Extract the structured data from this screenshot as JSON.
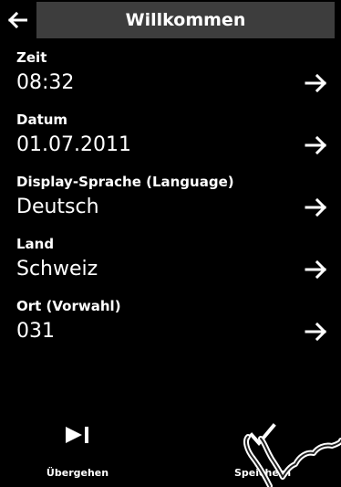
{
  "header": {
    "title": "Willkommen",
    "back_icon": "arrow-left-icon"
  },
  "settings": [
    {
      "label": "Zeit",
      "value": "08:32"
    },
    {
      "label": "Datum",
      "value": "01.07.2011"
    },
    {
      "label": "Display-Sprache (Language)",
      "value": "Deutsch"
    },
    {
      "label": "Land",
      "value": "Schweiz"
    },
    {
      "label": "Ort (Vorwahl)",
      "value": "031"
    }
  ],
  "footer": {
    "skip_label": "Übergehen",
    "skip_icon": "skip-forward-icon",
    "save_label": "Speichern",
    "save_icon": "checkmark-icon"
  },
  "colors": {
    "background": "#000000",
    "title_bar": "#3d3d3d",
    "text": "#ffffff"
  }
}
